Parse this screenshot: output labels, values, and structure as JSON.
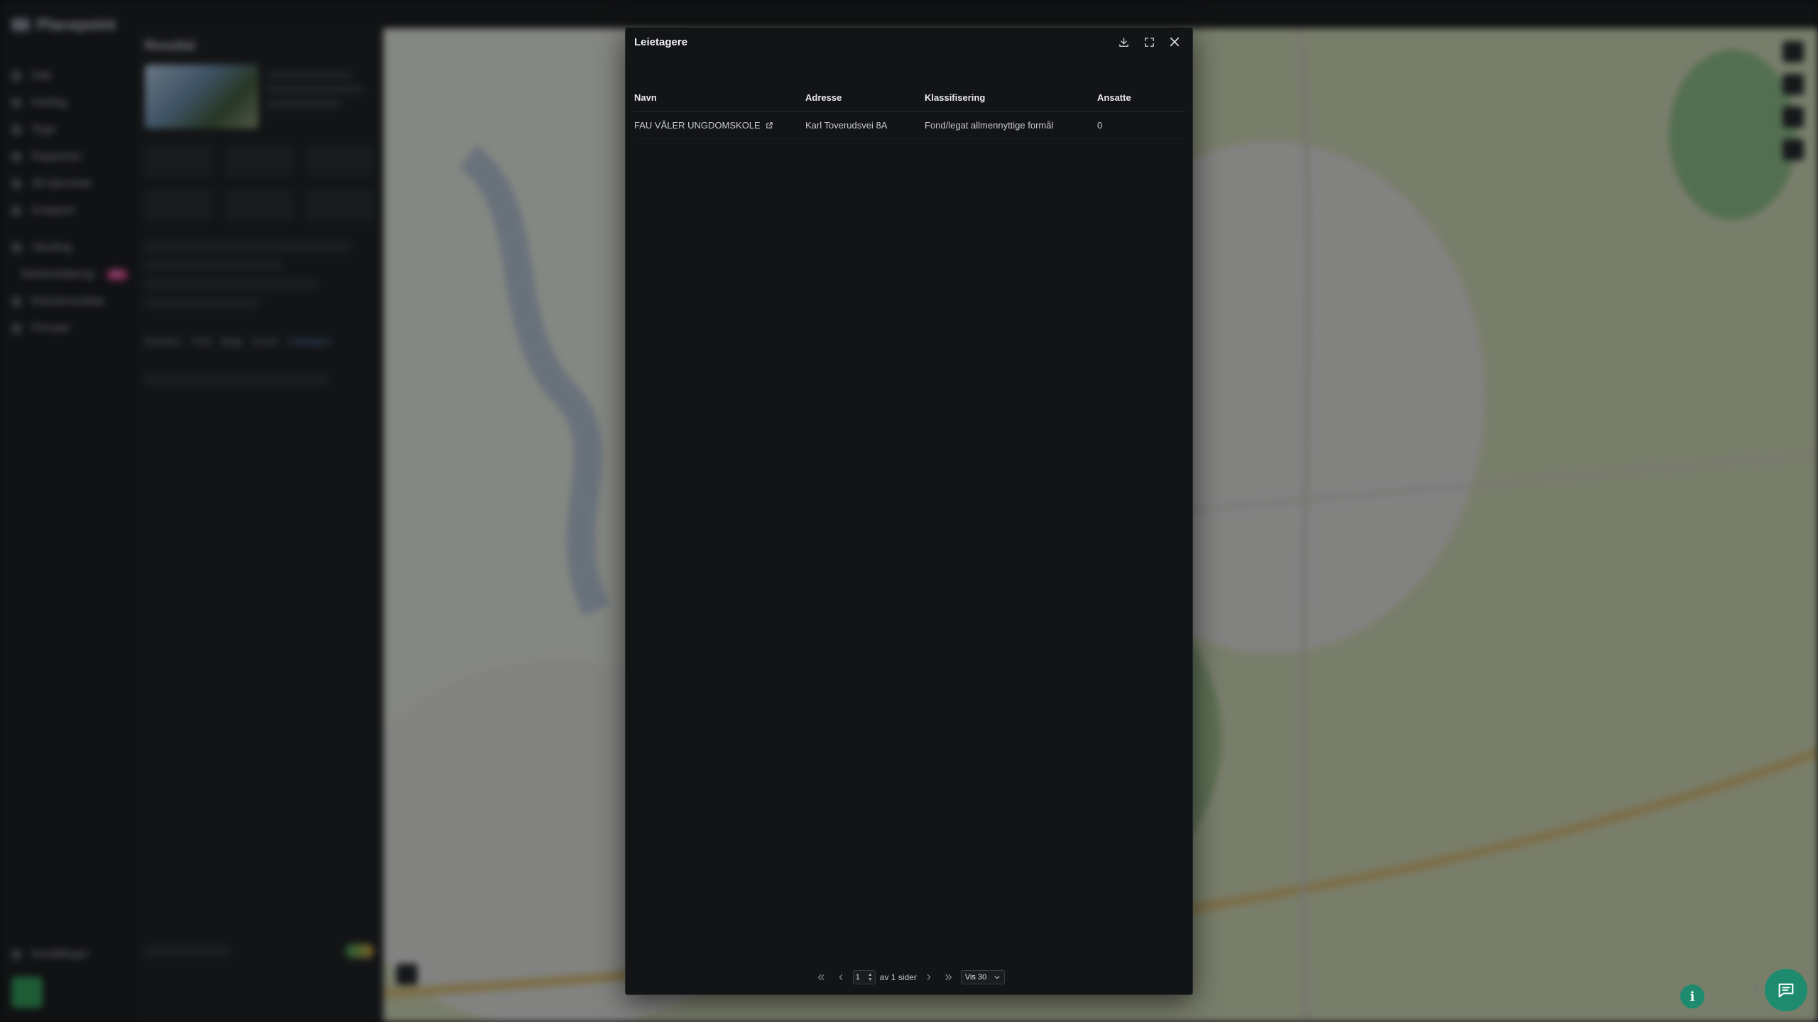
{
  "background": {
    "app_name": "Placepoint",
    "nav_items": [
      "Søk",
      "Kartlag",
      "Tegn",
      "Rapporter",
      "3D-tjenester",
      "Analyser",
      "Varsling",
      "Markedsføring",
      "Eiendomsdata",
      "Firmaer",
      "Innstillinger"
    ],
    "nav_badge": "NY",
    "panel_title": "Resultat",
    "panel_tabs": [
      "Eiendom",
      "Tomt",
      "Bygg",
      "Grunn",
      "Leietagere"
    ]
  },
  "modal": {
    "title": "Leietagere",
    "download_icon": "download-icon",
    "expand_icon": "expand-icon",
    "close_icon": "close-icon"
  },
  "table": {
    "headers": {
      "navn": "Navn",
      "adresse": "Adresse",
      "klassifisering": "Klassifisering",
      "ansatte": "Ansatte"
    },
    "rows": [
      {
        "navn": "FAU VÅLER UNGDOMSKOLE",
        "adresse": "Karl Toverudsvei 8A",
        "klassifisering": "Fond/legat allmennyttige formål",
        "ansatte": "0"
      }
    ]
  },
  "pagination": {
    "current_page": "1",
    "of_pages_text": "av 1 sider",
    "page_size_label": "Vis 30"
  },
  "colors": {
    "modal_bg": "#131416",
    "accent_green": "#1e8b6e",
    "map_bg": "#cfd7b8"
  }
}
